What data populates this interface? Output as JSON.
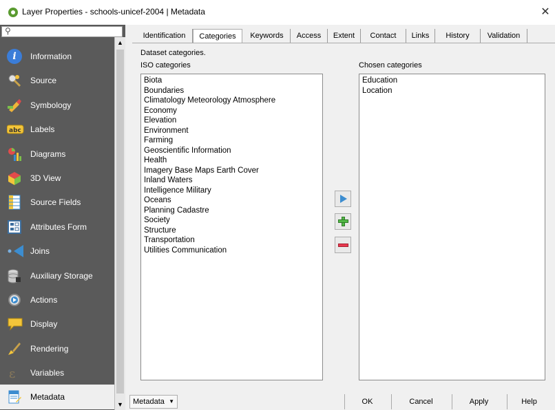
{
  "window": {
    "title": "Layer Properties - schools-unicef-2004 | Metadata",
    "close_glyph": "✕"
  },
  "search": {
    "icon": "search-icon",
    "glyph": "⚲"
  },
  "sidebar": {
    "items": [
      {
        "label": "Information",
        "icon": "info-icon"
      },
      {
        "label": "Source",
        "icon": "source-icon"
      },
      {
        "label": "Symbology",
        "icon": "symbology-icon"
      },
      {
        "label": "Labels",
        "icon": "labels-icon"
      },
      {
        "label": "Diagrams",
        "icon": "diagrams-icon"
      },
      {
        "label": "3D View",
        "icon": "3d-view-icon"
      },
      {
        "label": "Source Fields",
        "icon": "source-fields-icon"
      },
      {
        "label": "Attributes Form",
        "icon": "attributes-form-icon"
      },
      {
        "label": "Joins",
        "icon": "joins-icon"
      },
      {
        "label": "Auxiliary Storage",
        "icon": "auxiliary-storage-icon"
      },
      {
        "label": "Actions",
        "icon": "actions-icon"
      },
      {
        "label": "Display",
        "icon": "display-icon"
      },
      {
        "label": "Rendering",
        "icon": "rendering-icon"
      },
      {
        "label": "Variables",
        "icon": "variables-icon"
      },
      {
        "label": "Metadata",
        "icon": "metadata-icon"
      }
    ],
    "active": "Metadata"
  },
  "tabs": [
    {
      "label": "Identification"
    },
    {
      "label": "Categories"
    },
    {
      "label": "Keywords"
    },
    {
      "label": "Access"
    },
    {
      "label": "Extent"
    },
    {
      "label": "Contact"
    },
    {
      "label": "Links"
    },
    {
      "label": "History"
    },
    {
      "label": "Validation"
    }
  ],
  "active_tab": "Categories",
  "categories": {
    "heading": "Dataset categories.",
    "iso_label": "ISO categories",
    "chosen_label": "Chosen categories",
    "iso_list": [
      "Biota",
      "Boundaries",
      "Climatology Meteorology Atmosphere",
      "Economy",
      "Elevation",
      "Environment",
      "Farming",
      "Geoscientific Information",
      "Health",
      "Imagery Base Maps Earth Cover",
      "Inland Waters",
      "Intelligence Military",
      "Oceans",
      "Planning Cadastre",
      "Society",
      "Structure",
      "Transportation",
      "Utilities Communication"
    ],
    "chosen_list": [
      "Education",
      "Location"
    ],
    "colors": {
      "move_arrow": "#3c8dd0",
      "add": "#54b948",
      "remove": "#e8384f"
    }
  },
  "bottom": {
    "style_menu": "Metadata",
    "ok": "OK",
    "cancel": "Cancel",
    "apply": "Apply",
    "help": "Help"
  }
}
